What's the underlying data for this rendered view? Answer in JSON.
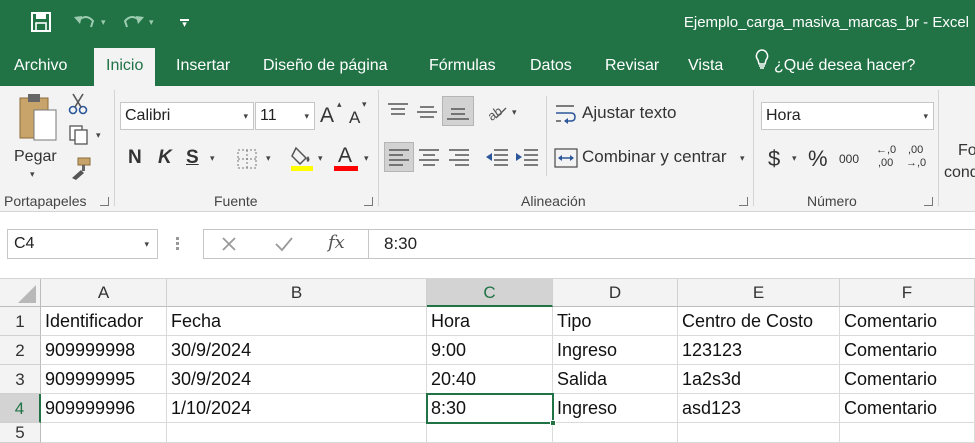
{
  "app": {
    "window_title": "Ejemplo_carga_masiva_marcas_br - Excel"
  },
  "quick_access": {
    "save_icon": "save-icon",
    "undo_icon": "undo-icon",
    "redo_icon": "redo-icon",
    "customize_icon": "customize-qat-icon"
  },
  "tabs": [
    {
      "label": "Archivo",
      "active": false
    },
    {
      "label": "Inicio",
      "active": true
    },
    {
      "label": "Insertar",
      "active": false
    },
    {
      "label": "Diseño de página",
      "active": false
    },
    {
      "label": "Fórmulas",
      "active": false
    },
    {
      "label": "Datos",
      "active": false
    },
    {
      "label": "Revisar",
      "active": false
    },
    {
      "label": "Vista",
      "active": false
    }
  ],
  "tell_me": {
    "placeholder": "¿Qué desea hacer?",
    "icon": "lightbulb-icon"
  },
  "ribbon": {
    "clipboard": {
      "label": "Portapapeles",
      "paste_label": "Pegar"
    },
    "font": {
      "label": "Fuente",
      "font_name": "Calibri",
      "font_size": "11",
      "grow_glyph": "A",
      "shrink_glyph": "A",
      "bold_glyph": "N",
      "italic_glyph": "K",
      "underline_glyph": "S",
      "font_color_glyph": "A",
      "highlight_color": "#ffff00",
      "font_color": "#ff0000"
    },
    "alignment": {
      "label": "Alineación",
      "wrap_text": "Ajustar texto",
      "merge_center": "Combinar y centrar"
    },
    "number": {
      "label": "Número",
      "format": "Hora",
      "currency_glyph": "$",
      "percent_glyph": "%",
      "thousands_glyph": "000",
      "inc_decimal_top": "←,0",
      "inc_decimal_bottom": ",00",
      "dec_decimal_top": ",00",
      "dec_decimal_bottom": "→,0"
    },
    "styles_partial": {
      "line1": "Fo",
      "line2": "cond"
    }
  },
  "formula_bar": {
    "name_box": "C4",
    "fx_glyph": "fx",
    "formula": "8:30"
  },
  "sheet": {
    "columns": [
      "A",
      "B",
      "C",
      "D",
      "E",
      "F"
    ],
    "selected_column": "C",
    "selected_row": "4",
    "rows": [
      {
        "num": "1",
        "cells": [
          "Identificador",
          "Fecha",
          "Hora",
          "Tipo",
          "Centro de Costo",
          "Comentario"
        ]
      },
      {
        "num": "2",
        "cells": [
          "909999998",
          "30/9/2024",
          "9:00",
          "Ingreso",
          "123123",
          "Comentario"
        ]
      },
      {
        "num": "3",
        "cells": [
          "909999995",
          "30/9/2024",
          "20:40",
          "Salida",
          "1a2s3d",
          "Comentario"
        ]
      },
      {
        "num": "4",
        "cells": [
          "909999996",
          "1/10/2024",
          "8:30",
          "Ingreso",
          "asd123",
          "Comentario"
        ]
      },
      {
        "num": "5",
        "cells": [
          "",
          "",
          "",
          "",
          "",
          ""
        ]
      }
    ]
  },
  "colors": {
    "excel_green": "#217346",
    "ribbon_bg": "#f3f3f3"
  }
}
